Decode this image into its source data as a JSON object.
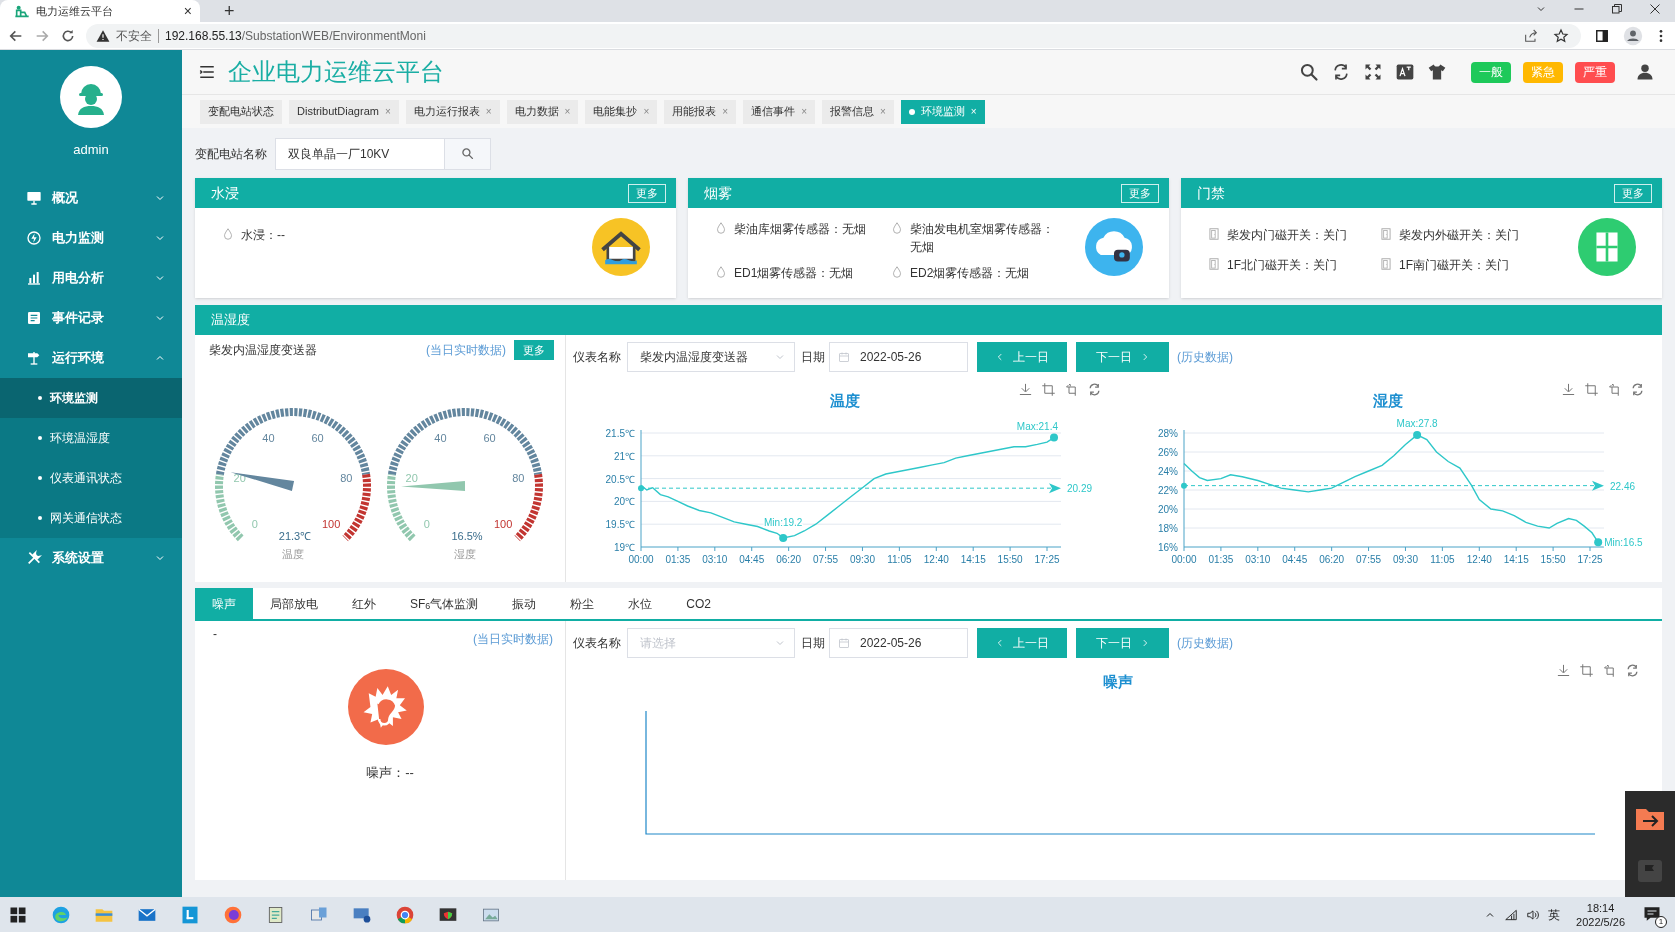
{
  "browser": {
    "tab_title": "电力运维云平台",
    "tab_close": "×",
    "new_tab": "+",
    "security": "不安全",
    "url_host": "192.168.55.13",
    "url_path": "/SubstationWEB/EnvironmentMoni"
  },
  "sidebar": {
    "user": "admin",
    "items": [
      {
        "label": "概况",
        "expanded": false
      },
      {
        "label": "电力监测",
        "expanded": false
      },
      {
        "label": "用电分析",
        "expanded": false
      },
      {
        "label": "事件记录",
        "expanded": false
      },
      {
        "label": "运行环境",
        "expanded": true,
        "children": [
          {
            "label": "环境监测",
            "selected": true
          },
          {
            "label": "环境温湿度",
            "selected": false
          },
          {
            "label": "仪表通讯状态",
            "selected": false
          },
          {
            "label": "网关通信状态",
            "selected": false
          }
        ]
      },
      {
        "label": "系统设置",
        "expanded": false
      }
    ]
  },
  "header": {
    "title": "企业电力运维云平台",
    "alarm_badges": [
      {
        "label": "一般",
        "color": "#1ec95a"
      },
      {
        "label": "紧急",
        "color": "#ffb800"
      },
      {
        "label": "严重",
        "color": "#ff4d4f"
      }
    ]
  },
  "tabs": [
    {
      "label": "变配电站状态",
      "selected": false
    },
    {
      "label": "DistributDiagram",
      "selected": false,
      "close": "×"
    },
    {
      "label": "电力运行报表",
      "selected": false,
      "close": "×"
    },
    {
      "label": "电力数据",
      "selected": false,
      "close": "×"
    },
    {
      "label": "电能集抄",
      "selected": false,
      "close": "×"
    },
    {
      "label": "用能报表",
      "selected": false,
      "close": "×"
    },
    {
      "label": "通信事件",
      "selected": false,
      "close": "×"
    },
    {
      "label": "报警信息",
      "selected": false,
      "close": "×"
    },
    {
      "label": "环境监测",
      "selected": true,
      "close": "×"
    }
  ],
  "station_filter": {
    "label": "变配电站名称",
    "value": "双良单晶一厂10KV"
  },
  "cards": [
    {
      "kind": "water",
      "title": "水浸",
      "more": "更多",
      "items": [
        "水浸：--"
      ]
    },
    {
      "kind": "smoke",
      "title": "烟雾",
      "more": "更多",
      "items": [
        "柴油库烟雾传感器：无烟",
        "柴油发电机室烟雾传感器：无烟",
        "ED1烟雾传感器：无烟",
        "ED2烟雾传感器：无烟"
      ]
    },
    {
      "kind": "door",
      "title": "门禁",
      "more": "更多",
      "items": [
        "柴发内门磁开关：关门",
        "柴发内外磁开关：关门",
        "1F北门磁开关：关门",
        "1F南门磁开关：关门"
      ]
    }
  ],
  "climate": {
    "title": "温湿度",
    "device": "柴发内温湿度变送器",
    "realtime_link": "(当日实时数据)",
    "more": "更多",
    "gauges": [
      {
        "level": 0.213,
        "reading": "21.3℃",
        "label": "温度",
        "ticks": [
          "0",
          "20",
          "40",
          "60",
          "80",
          "100"
        ]
      },
      {
        "level": 0.165,
        "reading": "16.5%",
        "label": "湿度",
        "ticks": [
          "0",
          "20",
          "40",
          "60",
          "80",
          "100"
        ]
      }
    ],
    "filter": {
      "meter_label": "仪表名称",
      "meter_value": "柴发内温湿度变送器",
      "date_label": "日期",
      "date": "2022-05-26",
      "prev": "上一日",
      "next": "下一日",
      "history_link": "(历史数据)"
    },
    "charts": [
      {
        "chart_data": {
          "type": "line",
          "title": "温度",
          "xlim": [
            0,
            1081
          ],
          "ylim": [
            19,
            21.5
          ],
          "x": [
            0,
            15,
            30,
            50,
            70,
            95,
            120,
            150,
            180,
            210,
            240,
            270,
            300,
            330,
            350,
            366,
            395,
            420,
            450,
            480,
            510,
            540,
            570,
            600,
            630,
            660,
            690,
            720,
            750,
            780,
            810,
            840,
            870,
            900,
            930,
            960,
            990,
            1020,
            1045,
            1063
          ],
          "values": [
            20.35,
            20.25,
            20.3,
            20.15,
            20.1,
            20.0,
            19.9,
            19.8,
            19.75,
            19.65,
            19.55,
            19.5,
            19.45,
            19.35,
            19.3,
            19.2,
            19.25,
            19.35,
            19.5,
            19.7,
            19.9,
            20.1,
            20.3,
            20.5,
            20.6,
            20.65,
            20.7,
            20.75,
            20.8,
            20.85,
            20.95,
            21.0,
            21.05,
            21.1,
            21.15,
            21.2,
            21.2,
            21.25,
            21.3,
            21.4
          ],
          "xticks": [
            {
              "value": 0,
              "label": "00:00"
            },
            {
              "value": 95,
              "label": "01:35"
            },
            {
              "value": 190,
              "label": "03:10"
            },
            {
              "value": 285,
              "label": "04:45"
            },
            {
              "value": 380,
              "label": "06:20"
            },
            {
              "value": 475,
              "label": "07:55"
            },
            {
              "value": 570,
              "label": "09:30"
            },
            {
              "value": 665,
              "label": "11:05"
            },
            {
              "value": 760,
              "label": "12:40"
            },
            {
              "value": 855,
              "label": "14:15"
            },
            {
              "value": 950,
              "label": "15:50"
            },
            {
              "value": 1045,
              "label": "17:25"
            }
          ],
          "yticks": [
            {
              "value": 19,
              "label": "19℃"
            },
            {
              "value": 19.5,
              "label": "19.5℃"
            },
            {
              "value": 20,
              "label": "20℃"
            },
            {
              "value": 20.5,
              "label": "20.5℃"
            },
            {
              "value": 21,
              "label": "21℃"
            },
            {
              "value": 21.5,
              "label": "21.5℃"
            }
          ],
          "grid": true,
          "annotations": [
            {
              "text": "Max:21.4",
              "x": 1063,
              "y": 21.4
            },
            {
              "text": "Min:19.2",
              "x": 366,
              "y": 19.2
            }
          ],
          "ref_lines": [
            {
              "axis": "y",
              "value": 20.29,
              "label": "20.29"
            }
          ]
        }
      },
      {
        "chart_data": {
          "type": "line",
          "title": "湿度",
          "xlim": [
            0,
            1081
          ],
          "ylim": [
            16,
            28
          ],
          "x": [
            0,
            20,
            40,
            60,
            95,
            120,
            150,
            190,
            220,
            250,
            285,
            320,
            350,
            380,
            410,
            440,
            475,
            510,
            540,
            570,
            600,
            625,
            650,
            680,
            710,
            740,
            760,
            790,
            820,
            850,
            880,
            910,
            940,
            960,
            990,
            1010,
            1030,
            1050,
            1066
          ],
          "values": [
            24.8,
            24.0,
            23.3,
            23.0,
            23.2,
            23.6,
            23.4,
            23.0,
            22.6,
            22.2,
            22.0,
            21.8,
            22.0,
            22.2,
            22.8,
            23.4,
            24.0,
            24.6,
            25.6,
            26.8,
            27.8,
            27.3,
            26.0,
            25.0,
            24.3,
            22.5,
            21.0,
            20.0,
            19.8,
            19.3,
            18.6,
            18.2,
            18.0,
            18.5,
            19.0,
            18.8,
            18.2,
            17.5,
            16.5
          ],
          "xticks": [
            {
              "value": 0,
              "label": "00:00"
            },
            {
              "value": 95,
              "label": "01:35"
            },
            {
              "value": 190,
              "label": "03:10"
            },
            {
              "value": 285,
              "label": "04:45"
            },
            {
              "value": 380,
              "label": "06:20"
            },
            {
              "value": 475,
              "label": "07:55"
            },
            {
              "value": 570,
              "label": "09:30"
            },
            {
              "value": 665,
              "label": "11:05"
            },
            {
              "value": 760,
              "label": "12:40"
            },
            {
              "value": 855,
              "label": "14:15"
            },
            {
              "value": 950,
              "label": "15:50"
            },
            {
              "value": 1045,
              "label": "17:25"
            }
          ],
          "yticks": [
            {
              "value": 16,
              "label": "16%"
            },
            {
              "value": 18,
              "label": "18%"
            },
            {
              "value": 20,
              "label": "20%"
            },
            {
              "value": 22,
              "label": "22%"
            },
            {
              "value": 24,
              "label": "24%"
            },
            {
              "value": 26,
              "label": "26%"
            },
            {
              "value": 28,
              "label": "28%"
            }
          ],
          "grid": true,
          "annotations": [
            {
              "text": "Max:27.8",
              "x": 600,
              "y": 27.8
            },
            {
              "text": "Min:16.5",
              "x": 1066,
              "y": 16.5
            }
          ],
          "ref_lines": [
            {
              "axis": "y",
              "value": 22.46,
              "label": "22.46"
            }
          ]
        }
      }
    ]
  },
  "sensor_tabs": [
    {
      "label": "噪声",
      "selected": true
    },
    {
      "label": "局部放电",
      "selected": false
    },
    {
      "label": "红外",
      "selected": false
    },
    {
      "label": "SF$_{6}$气体监测",
      "selected": false
    },
    {
      "label": "振动",
      "selected": false
    },
    {
      "label": "粉尘",
      "selected": false
    },
    {
      "label": "水位",
      "selected": false
    },
    {
      "label": "CO2",
      "selected": false
    }
  ],
  "noise": {
    "device": "-",
    "realtime_link": "(当日实时数据)",
    "reading": "噪声：--",
    "filter": {
      "meter_label": "仪表名称",
      "meter_placeholder": "请选择",
      "date_label": "日期",
      "date": "2022-05-26",
      "prev": "上一日",
      "next": "下一日",
      "history_link": "(历史数据)"
    },
    "chart_title": "噪声"
  },
  "taskbar": {
    "ime": "英",
    "time": "18:14",
    "date": "2022/5/26",
    "notifications": "1"
  }
}
